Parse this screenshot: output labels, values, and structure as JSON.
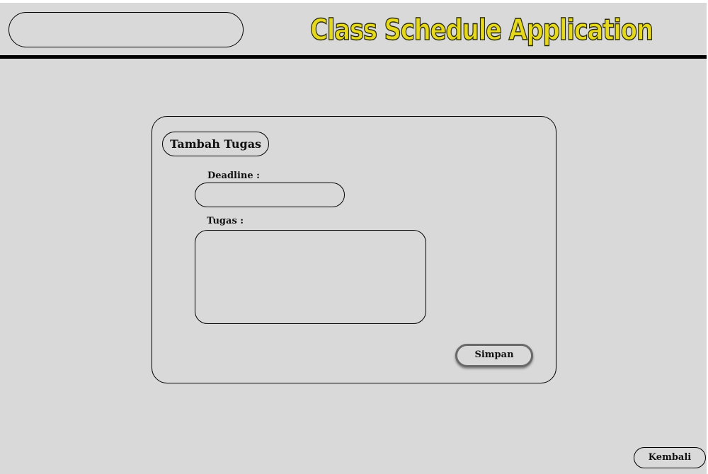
{
  "header": {
    "app_title": "Class Schedule Application",
    "search_value": ""
  },
  "form": {
    "title": "Tambah Tugas",
    "deadline_label": "Deadline :",
    "deadline_value": "",
    "tugas_label": "Tugas :",
    "tugas_value": "",
    "save_label": "Simpan"
  },
  "footer": {
    "back_label": "Kembali"
  },
  "colors": {
    "background": "#d9d9d9",
    "title_accent": "#e5d81f",
    "header_rule": "#000000"
  }
}
